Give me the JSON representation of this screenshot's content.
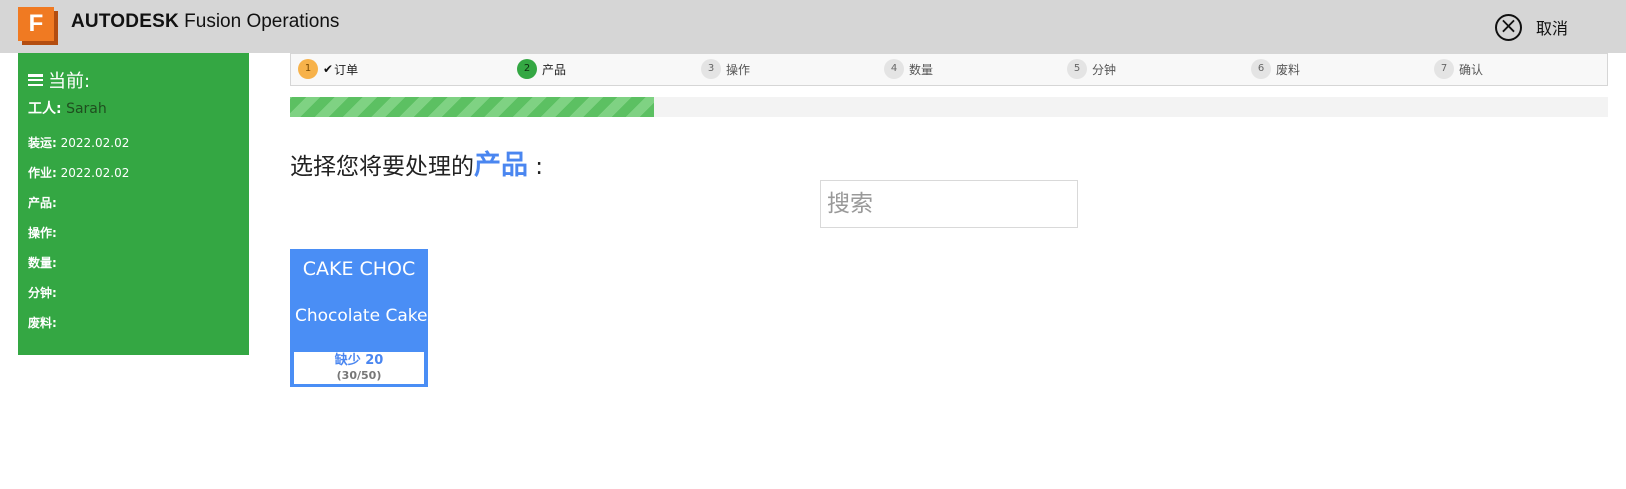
{
  "header": {
    "logo_letter": "F",
    "brand_bold": "AUTODESK",
    "brand_product": "Fusion Operations",
    "cancel_label": "取消",
    "cancel_icon": "close-circle-icon"
  },
  "sidebar": {
    "title": "当前:",
    "worker_label": "工人:",
    "worker_value": "Sarah",
    "rows": [
      {
        "label": "装运:",
        "value": "2022.02.02"
      },
      {
        "label": "作业:",
        "value": "2022.02.02"
      },
      {
        "label": "产品:",
        "value": ""
      },
      {
        "label": "操作:",
        "value": ""
      },
      {
        "label": "数量:",
        "value": ""
      },
      {
        "label": "分钟:",
        "value": ""
      },
      {
        "label": "废料:",
        "value": ""
      }
    ]
  },
  "steps": [
    {
      "num": "1",
      "label": "订单",
      "state": "done"
    },
    {
      "num": "2",
      "label": "产品",
      "state": "active"
    },
    {
      "num": "3",
      "label": "操作",
      "state": "pending"
    },
    {
      "num": "4",
      "label": "数量",
      "state": "pending"
    },
    {
      "num": "5",
      "label": "分钟",
      "state": "pending"
    },
    {
      "num": "6",
      "label": "废料",
      "state": "pending"
    },
    {
      "num": "7",
      "label": "确认",
      "state": "pending"
    }
  ],
  "progress": {
    "fraction": 0.276
  },
  "main": {
    "heading_prefix": "选择您将要处理的",
    "heading_highlight": "产品",
    "heading_suffix": " :",
    "search_placeholder": "搜索"
  },
  "products": [
    {
      "code": "CAKE CHOC",
      "name": "Chocolate Cake",
      "shortage": "缺少 20",
      "ratio": "(30/50)"
    }
  ],
  "colors": {
    "topbar": "#d6d6d6",
    "sidebar": "#34a743",
    "accent": "#4a86f0",
    "card": "#4a8ef5",
    "step_done": "#f7b24a",
    "step_active": "#34a743"
  }
}
